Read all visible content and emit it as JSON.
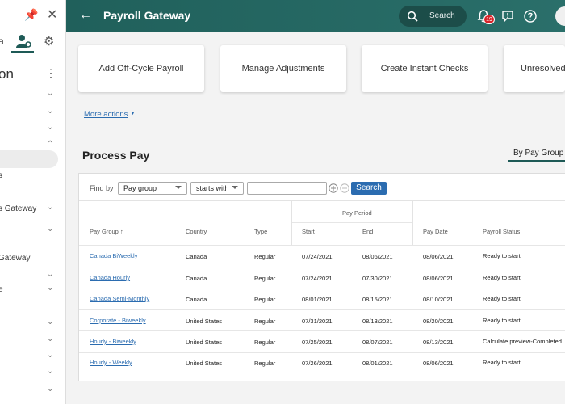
{
  "sidebar": {
    "title": "on",
    "tab_a": "a",
    "items": [
      {
        "label": "s"
      },
      {
        "label": "s Gateway"
      },
      {
        "label": "Gateway"
      },
      {
        "label": "e"
      }
    ]
  },
  "header": {
    "title": "Payroll Gateway",
    "search_label": "Search",
    "notification_count": "19"
  },
  "actions": [
    {
      "label": "Add Off-Cycle Payroll"
    },
    {
      "label": "Manage Adjustments"
    },
    {
      "label": "Create Instant Checks"
    },
    {
      "label": "Unresolved"
    }
  ],
  "more_actions": "More actions",
  "section_title": "Process Pay",
  "view_tab": "By Pay Group",
  "filter": {
    "label": "Find by",
    "field": "Pay group",
    "operator": "starts with",
    "value": "",
    "search_button": "Search"
  },
  "table": {
    "group_header": "Pay Period",
    "columns": [
      "Pay Group",
      "Country",
      "Type",
      "Start",
      "End",
      "Pay Date",
      "Payroll Status"
    ],
    "sort_indicator": "↑",
    "rows": [
      {
        "pay_group": "Canada BiWeekly",
        "country": "Canada",
        "type": "Regular",
        "start": "07/24/2021",
        "end": "08/06/2021",
        "pay_date": "08/06/2021",
        "status": "Ready to start"
      },
      {
        "pay_group": "Canada Hourly",
        "country": "Canada",
        "type": "Regular",
        "start": "07/24/2021",
        "end": "07/30/2021",
        "pay_date": "08/06/2021",
        "status": "Ready to start"
      },
      {
        "pay_group": "Canada Semi-Monthly",
        "country": "Canada",
        "type": "Regular",
        "start": "08/01/2021",
        "end": "08/15/2021",
        "pay_date": "08/10/2021",
        "status": "Ready to start"
      },
      {
        "pay_group": "Corporate - Biweekly",
        "country": "United States",
        "type": "Regular",
        "start": "07/31/2021",
        "end": "08/13/2021",
        "pay_date": "08/20/2021",
        "status": "Ready to start"
      },
      {
        "pay_group": "Hourly - Biweekly",
        "country": "United States",
        "type": "Regular",
        "start": "07/25/2021",
        "end": "08/07/2021",
        "pay_date": "08/13/2021",
        "status": "Calculate preview-Completed"
      },
      {
        "pay_group": "Hourly - Weekly",
        "country": "United States",
        "type": "Regular",
        "start": "07/26/2021",
        "end": "08/01/2021",
        "pay_date": "08/06/2021",
        "status": "Ready to start"
      }
    ]
  },
  "colors": {
    "header": "#20605b",
    "link": "#2b6cb0",
    "badge": "#d8232a"
  }
}
